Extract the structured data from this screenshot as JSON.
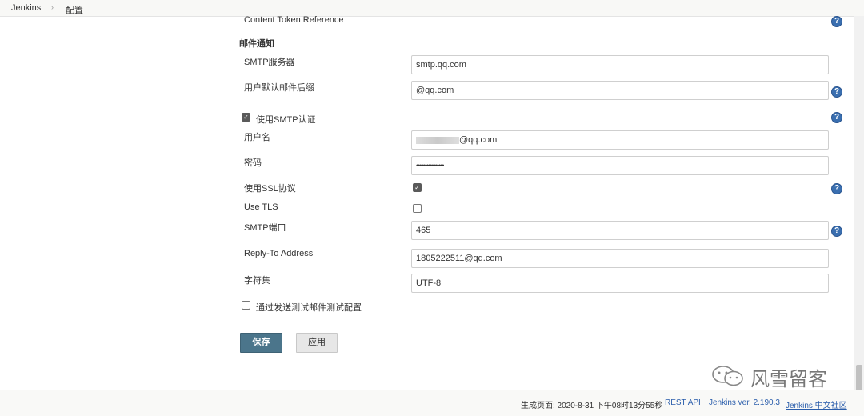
{
  "breadcrumb": {
    "items": [
      "Jenkins",
      "配置"
    ],
    "separator": "›"
  },
  "content_token": {
    "label": "Content Token Reference"
  },
  "section": {
    "title": "邮件通知"
  },
  "smtp_server": {
    "label": "SMTP服务器",
    "value": "smtp.qq.com"
  },
  "default_suffix": {
    "label": "用户默认邮件后缀",
    "value": "@qq.com"
  },
  "smtp_auth": {
    "label": "使用SMTP认证",
    "checked": true
  },
  "username": {
    "label": "用户名",
    "value": "@qq.com"
  },
  "password": {
    "label": "密码",
    "value": "••••••••••••••••"
  },
  "use_ssl": {
    "label": "使用SSL协议",
    "checked": true
  },
  "use_tls": {
    "label": "Use TLS",
    "checked": false
  },
  "smtp_port": {
    "label": "SMTP端口",
    "value": "465"
  },
  "reply_to": {
    "label": "Reply-To Address",
    "value": "1805222511@qq.com"
  },
  "charset": {
    "label": "字符集",
    "value": "UTF-8"
  },
  "test_config": {
    "label": "通过发送测试邮件测试配置",
    "checked": false
  },
  "buttons": {
    "save": "保存",
    "apply": "应用"
  },
  "help": {
    "glyph": "?",
    "icon": "help-icon"
  },
  "check": {
    "glyph": "✓"
  },
  "footer": {
    "generated": "生成页面: 2020-8-31 下午08时13分55秒",
    "rest_api": "REST API",
    "version": "Jenkins ver. 2.190.3",
    "community": "Jenkins 中文社区"
  },
  "watermark": {
    "text": "风雪留客"
  },
  "colors": {
    "save_button": "#4b758b",
    "help_icon": "#3a6fb0",
    "link": "#2a5dab"
  }
}
